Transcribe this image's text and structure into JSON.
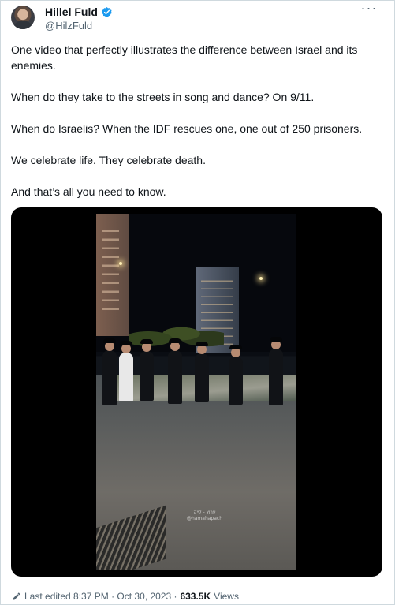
{
  "post": {
    "author_name": "Hillel Fuld",
    "handle": "@HilzFuld",
    "more_label": "···",
    "paragraphs": [
      "One video that perfectly illustrates the difference between Israel and its enemies.",
      "When do they take to the streets in song and dance? On 9/11.",
      "When do Israelis? When the IDF rescues one, one out of 250 prisoners.",
      "We celebrate life. They celebrate death.",
      "And that’s all you need to know."
    ],
    "footer": {
      "edited_text": "Last edited 8:37 PM · Oct 30, 2023 ·",
      "views_count": "633.5K",
      "views_label": "Views"
    }
  },
  "icons": {
    "avatar": "profile-photo",
    "verified": "verified-badge-icon",
    "more": "more-options-icon",
    "edit": "pencil-edit-icon"
  },
  "colors": {
    "text": "#0f1419",
    "muted": "#536471",
    "verified": "#1d9bf0",
    "border": "#cfd9de",
    "media_background": "#000000"
  },
  "media": {
    "type": "video",
    "watermark_lines": [
      "ערוץ - לייק",
      "@hamahapach"
    ]
  }
}
